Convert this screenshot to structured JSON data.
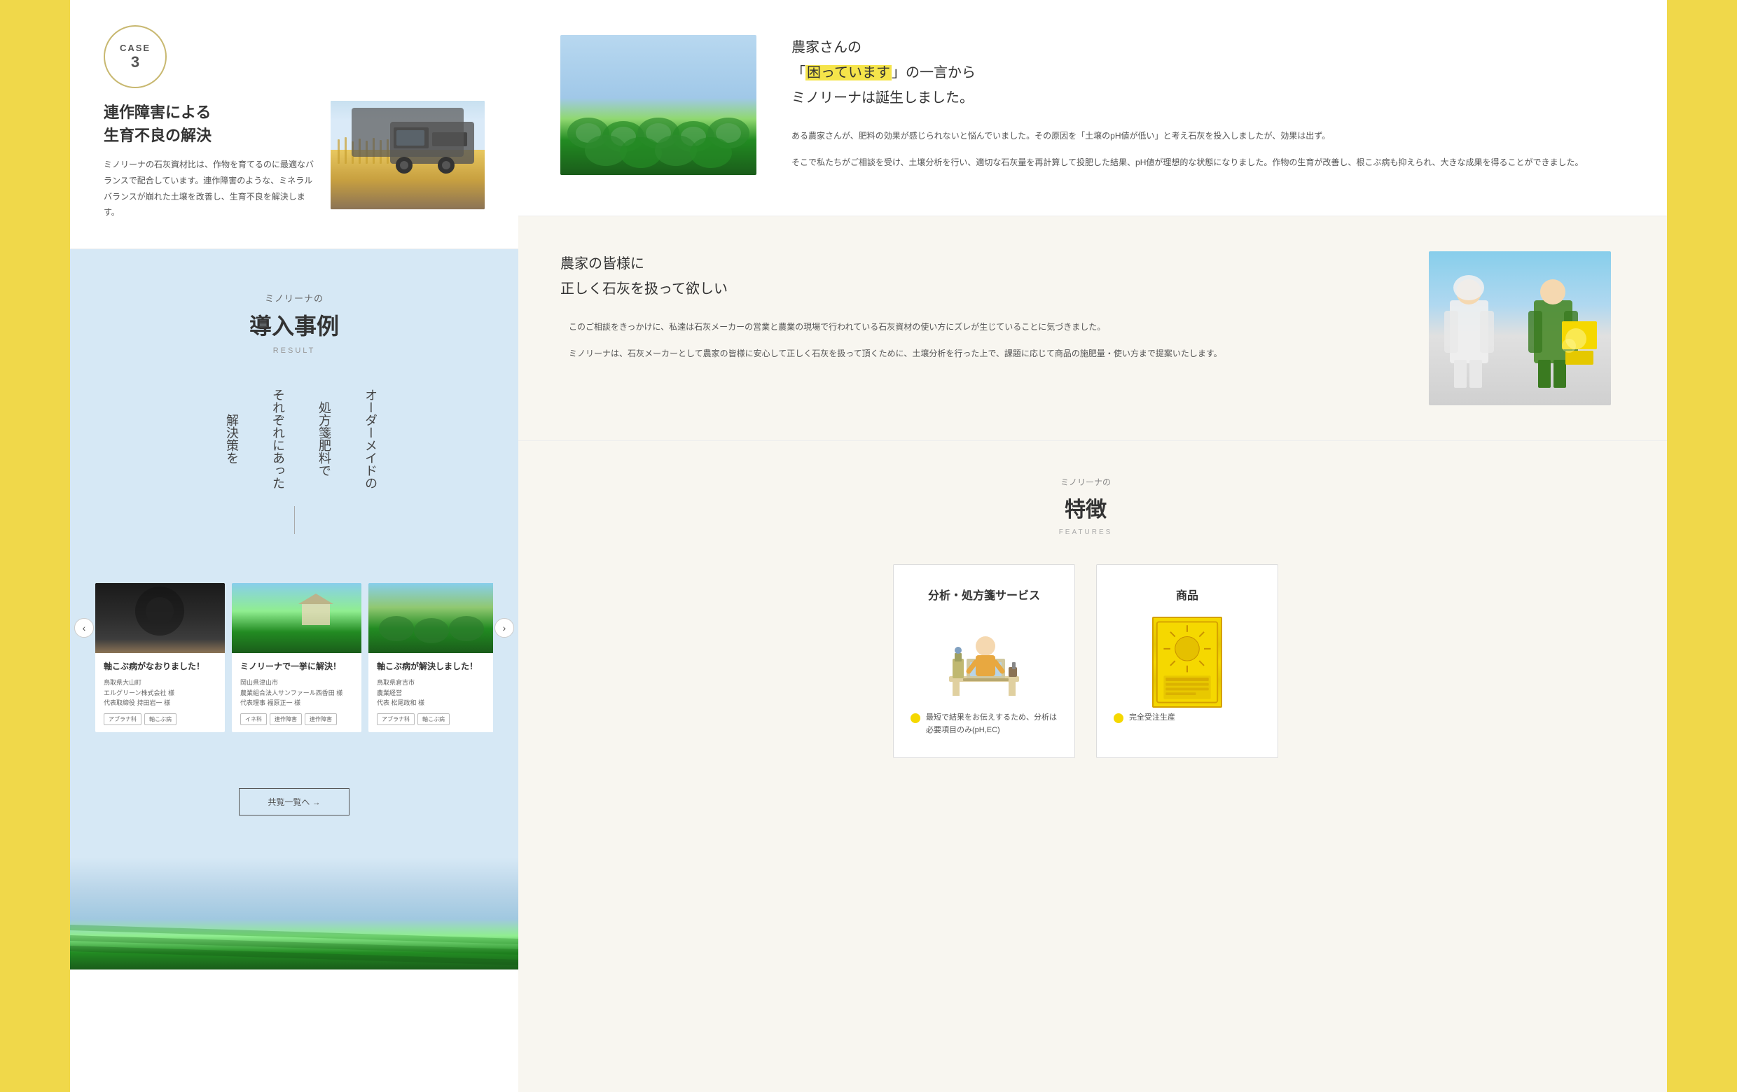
{
  "left": {
    "case_label": "CASE",
    "case_number": "3",
    "case_title_line1": "連作障害による",
    "case_title_line2": "生育不良の解決",
    "case_desc": "ミノリーナの石灰資材比は、作物を育てるのに最適なバランスで配合しています。連作障害のような、ミネラルバランスが崩れた土壌を改善し、生育不良を解決します。",
    "intro_subtitle": "ミノリーナの",
    "intro_title": "導入事例",
    "intro_result": "RESULT",
    "solution_items": [
      "解決策を",
      "それぞれにあった",
      "処方箋肥料で",
      "オーダーメイドの"
    ],
    "cards": [
      {
        "title": "軸こぶ病がなおりました！",
        "meta_line1": "鳥取県大山町",
        "meta_line2": "エルグリーン株式会社 様",
        "meta_line3": "代表取締役 持田岩一 様",
        "tags": [
          "アブラナ科",
          "軸こぶ病"
        ]
      },
      {
        "title": "ミノリーナで一挙に解決！",
        "meta_line1": "岡山県津山市",
        "meta_line2": "農業組合法人サンファール西香田 様",
        "meta_line3": "代表理事 福原正一 様",
        "tags": [
          "イネ科",
          "連作障害",
          "連作障害"
        ]
      },
      {
        "title": "軸こぶ病が解決しました！",
        "meta_line1": "鳥取県倉吉市",
        "meta_line2": "農業経営",
        "meta_line3": "代表 松尾政和 様",
        "tags": [
          "アブラナ科",
          "軸こぶ病"
        ]
      }
    ],
    "more_btn": "共覧一覧へ →"
  },
  "right": {
    "origin_title_line1": "農家さんの",
    "origin_title_line2_pre": "「",
    "origin_title_highlight": "困っています",
    "origin_title_line2_post": "」の一言から",
    "origin_title_line3": "ミノリーナは誕生しました。",
    "origin_desc1": "ある農家さんが、肥料の効果が感じられないと悩んでいました。その原因を「土壌のpH値が低い」と考え石灰を投入しましたが、効果は出ず。",
    "origin_desc2": "そこで私たちがご相談を受け、土壌分析を行い、適切な石灰量を再計算して投肥した結果、pH値が理想的な状態になりました。作物の生育が改善し、根こぶ病も抑えられ、大きな成果を得ることができました。",
    "mission_title_line1": "農家の皆様に",
    "mission_title_line2": "正しく石灰を扱って欲しい",
    "mission_desc1": "　このご相談をきっかけに、私達は石灰メーカーの営業と農業の現場で行われている石灰資材の使い方にズレが生じていることに気づきました。",
    "mission_desc2": "　ミノリーナは、石灰メーカーとして農家の皆様に安心して正しく石灰を扱って頂くために、土壌分析を行った上で、課題に応じて商品の施肥量・使い方まで提案いたします。",
    "features_subtitle": "ミノリーナの",
    "features_title": "特徴",
    "features_label": "FEATURES",
    "feature1_title": "分析・処方箋サービス",
    "feature1_bullet": "最短で結果をお伝えするため、分析は必要項目のみ(pH,EC)",
    "feature2_title": "商品",
    "feature2_bullet": "完全受注生産"
  }
}
